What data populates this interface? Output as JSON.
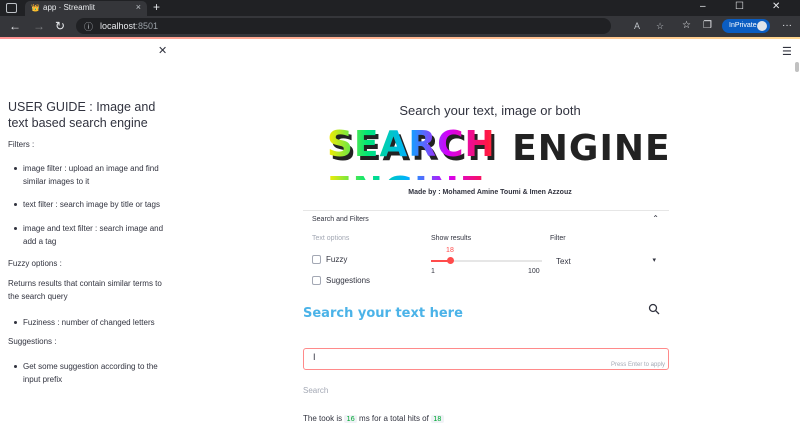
{
  "browser": {
    "tab_title": "app · Streamlit",
    "url_host": "localhost",
    "url_port": ":8501",
    "inprivate_label": "InPrivate"
  },
  "sidebar": {
    "title": "USER GUIDE : Image and text based search engine",
    "filters_heading": "Filters :",
    "filters": [
      "image filter : upload an image and find similar images to it",
      "text filter : search image by title or tags",
      "image and text filter : search image and add a tag"
    ],
    "fuzzy_heading": "Fuzzy options :",
    "fuzzy_desc": "Returns results that contain similar terms to the search query",
    "fuzzy_items": [
      "Fuziness : number of changed letters"
    ],
    "suggestions_heading": "Suggestions :",
    "suggestion_items": [
      "Get some suggestion according to the input prefix"
    ]
  },
  "main": {
    "subtitle": "Search your text, image or both",
    "logo_text": "SEARCH ENGINE",
    "made_by": "Made by : Mohamed Amine Toumi & Imen Azzouz",
    "panel": {
      "title": "Search and Filters",
      "text_options_label": "Text options",
      "fuzzy_label": "Fuzzy",
      "suggestions_label": "Suggestions",
      "show_results_label": "Show results",
      "slider_value": 18,
      "slider_min": "1",
      "slider_max": "100",
      "filter_label": "Filter",
      "filter_value": "Text"
    },
    "search_heading": "Search your text here",
    "input_hint": "Press Enter to apply",
    "search_button": "Search",
    "result_prefix": "The took is",
    "result_ms": "16",
    "result_mid": "ms for a total hits of",
    "result_hits": "18"
  },
  "colors": {
    "accent": "#ff4b4b",
    "heading_blue": "#4bb3e8",
    "text": "#31333f"
  }
}
